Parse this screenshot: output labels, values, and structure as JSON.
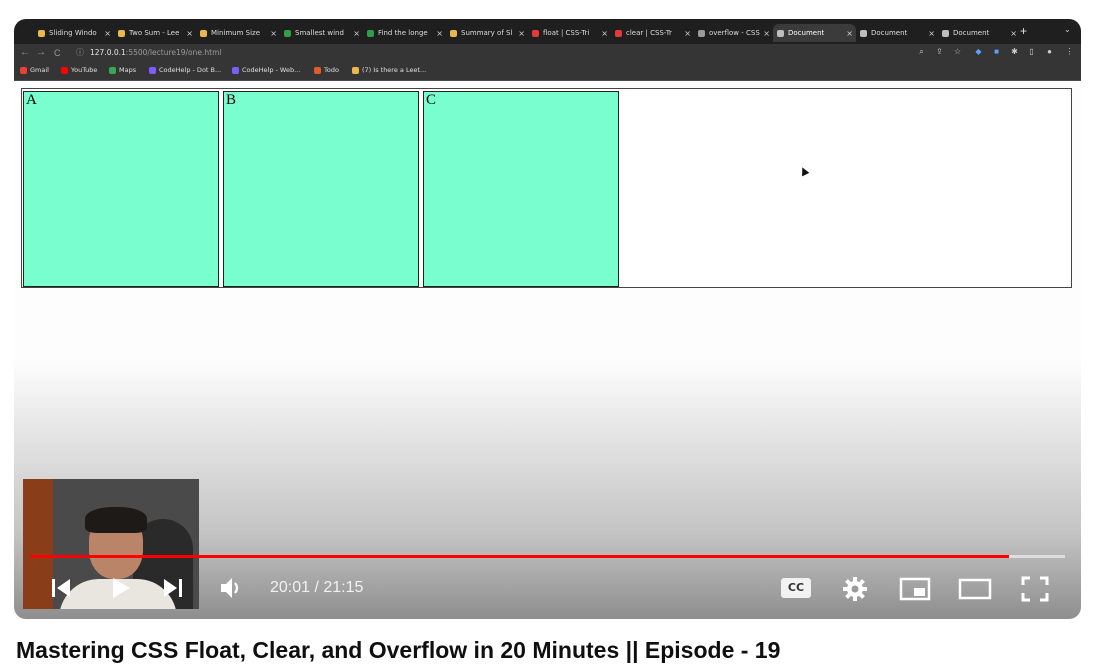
{
  "browser": {
    "tabs": [
      {
        "label": "Sliding Windo",
        "color": "#e8b84a"
      },
      {
        "label": "Two Sum - Lee",
        "color": "#e8b84a"
      },
      {
        "label": "Minimum Size",
        "color": "#e8b84a"
      },
      {
        "label": "Smallest wind",
        "color": "#2f9e44"
      },
      {
        "label": "Find the longe",
        "color": "#2f9e44"
      },
      {
        "label": "Summary of Sl",
        "color": "#e8b84a"
      },
      {
        "label": "float | CSS-Tri",
        "color": "#e03a3a"
      },
      {
        "label": "clear | CSS-Tr",
        "color": "#e03a3a"
      },
      {
        "label": "overflow - CSS",
        "color": "#9a9a9a"
      },
      {
        "label": "Document",
        "color": "#bdbdbd",
        "active": true
      },
      {
        "label": "Document",
        "color": "#bdbdbd"
      },
      {
        "label": "Document",
        "color": "#bdbdbd"
      }
    ],
    "new_tab": "+",
    "url_host": "127.0.0.1",
    "url_path": ":5500/lecture19/one.html",
    "bookmarks": [
      {
        "label": "Gmail",
        "color": "#e94235"
      },
      {
        "label": "YouTube",
        "color": "#ff0000"
      },
      {
        "label": "Maps",
        "color": "#34a853"
      },
      {
        "label": "CodeHelp - Dot B...",
        "color": "#7c5cff"
      },
      {
        "label": "CodeHelp - Web...",
        "color": "#7c5cff"
      },
      {
        "label": "Todo",
        "color": "#e05a2a"
      },
      {
        "label": "(7) Is there a Leet...",
        "color": "#e8b84a"
      }
    ]
  },
  "page": {
    "boxes": [
      "A",
      "B",
      "C"
    ],
    "box_color": "#78fecf"
  },
  "player": {
    "time_current": "20:01",
    "time_total": "21:15",
    "time_display": "20:01 / 21:15",
    "progress_fraction": 0.946,
    "progress_color": "#ff0000",
    "cc_label": "CC"
  },
  "video": {
    "title": "Mastering CSS Float, Clear, and Overflow in 20 Minutes || Episode - 19"
  }
}
